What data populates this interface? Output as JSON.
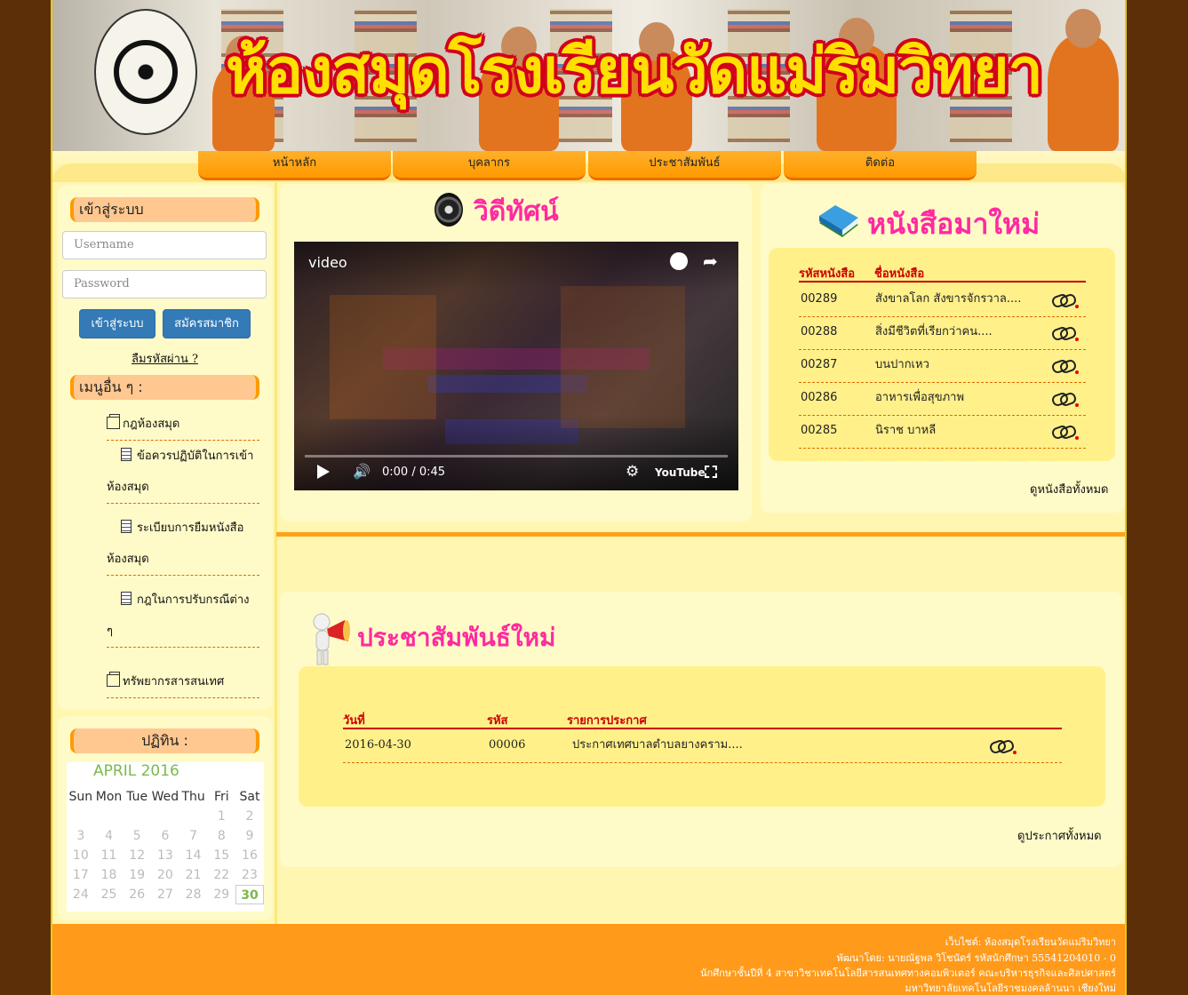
{
  "banner": {
    "title": "ห้องสมุดโรงเรียนวัดแม่ริมวิทยา"
  },
  "nav": [
    "หน้าหลัก",
    "บุคลากร",
    "ประชาสัมพันธ์",
    "ติดต่อ"
  ],
  "login": {
    "heading": "เข้าสู่ระบบ",
    "username_placeholder": "Username",
    "password_placeholder": "Password",
    "login_button": "เข้าสู่ระบบ",
    "register_button": "สมัครสมาชิก",
    "forgot_link": "ลืมรหัสผ่าน ?"
  },
  "other_menu": {
    "heading": "เมนูอื่น ๆ :",
    "items": [
      {
        "label": "กฎห้องสมุด",
        "icon": "folder-icon"
      },
      {
        "label": "ข้อควรปฏิบัติในการเข้าห้องสมุด",
        "line1": "ข้อควรปฏิบัติในการเข้า",
        "line2": "ห้องสมุด",
        "icon": "document-icon"
      },
      {
        "label": "ระเบียบการยืมหนังสือห้องสมุด",
        "line1": "ระเบียบการยืมหนังสือ",
        "line2": "ห้องสมุด",
        "icon": "document-icon"
      },
      {
        "label": "กฎในการปรับกรณีต่าง ๆ",
        "line1": "กฎในการปรับกรณีต่าง",
        "line2": "ๆ",
        "icon": "document-icon"
      },
      {
        "label": "ทรัพยากรสารสนเทศ",
        "icon": "folder-icon"
      }
    ]
  },
  "calendar": {
    "heading": "ปฏิทิน :",
    "month": "APRIL 2016",
    "weekdays": [
      "Sun",
      "Mon",
      "Tue",
      "Wed",
      "Thu",
      "Fri",
      "Sat"
    ],
    "weeks": [
      [
        "",
        "",
        "",
        "",
        "",
        "1",
        "2"
      ],
      [
        "3",
        "4",
        "5",
        "6",
        "7",
        "8",
        "9"
      ],
      [
        "10",
        "11",
        "12",
        "13",
        "14",
        "15",
        "16"
      ],
      [
        "17",
        "18",
        "19",
        "20",
        "21",
        "22",
        "23"
      ],
      [
        "24",
        "25",
        "26",
        "27",
        "28",
        "29",
        "30"
      ]
    ],
    "today": "30"
  },
  "video": {
    "heading": "วิดีทัศน์",
    "label": "video",
    "time": "0:00 / 0:45",
    "youtube": "YouTube"
  },
  "new_books": {
    "heading": "หนังสือมาใหม่",
    "columns": [
      "รหัสหนังสือ",
      "ชื่อหนังสือ"
    ],
    "rows": [
      {
        "code": "00289",
        "title": "สังขาลโลก สังขารจักรวาล...."
      },
      {
        "code": "00288",
        "title": "สิ่งมีชีวิตที่เรียกว่าคน...."
      },
      {
        "code": "00287",
        "title": "บนปากเหว"
      },
      {
        "code": "00286",
        "title": "อาหารเพื่อสุขภาพ"
      },
      {
        "code": "00285",
        "title": "นิราช บาหลี"
      }
    ],
    "see_all": "ดูหนังสือทั้งหมด"
  },
  "news": {
    "heading": "ประชาสัมพันธ์ใหม่",
    "columns": [
      "วันที่",
      "รหัส",
      "รายการประกาศ"
    ],
    "rows": [
      {
        "date": "2016-04-30",
        "code": "00006",
        "title": "ประกาศเทศบาลตำบลยางคราม...."
      }
    ],
    "see_all": "ดูประกาศทั้งหมด"
  },
  "footer": [
    "เว็บไซต์: ห้องสมุดโรงเรียนวัดแม่ริมวิทยา",
    "พัฒนาโดย: นายณัฐพล วิโชนัดร์ รหัสนักศึกษา 55541204010 - 0",
    "นักศึกษาชั้นปีที่ 4 สาขาวิชาเทคโนโลยีสารสนเทศทางคอมพิวเตอร์ คณะบริหารธุรกิจและศิลปศาสตร์",
    "มหาวิทยาลัยเทคโนโลยีราชมงคลล้านนา เชียงใหม่"
  ]
}
